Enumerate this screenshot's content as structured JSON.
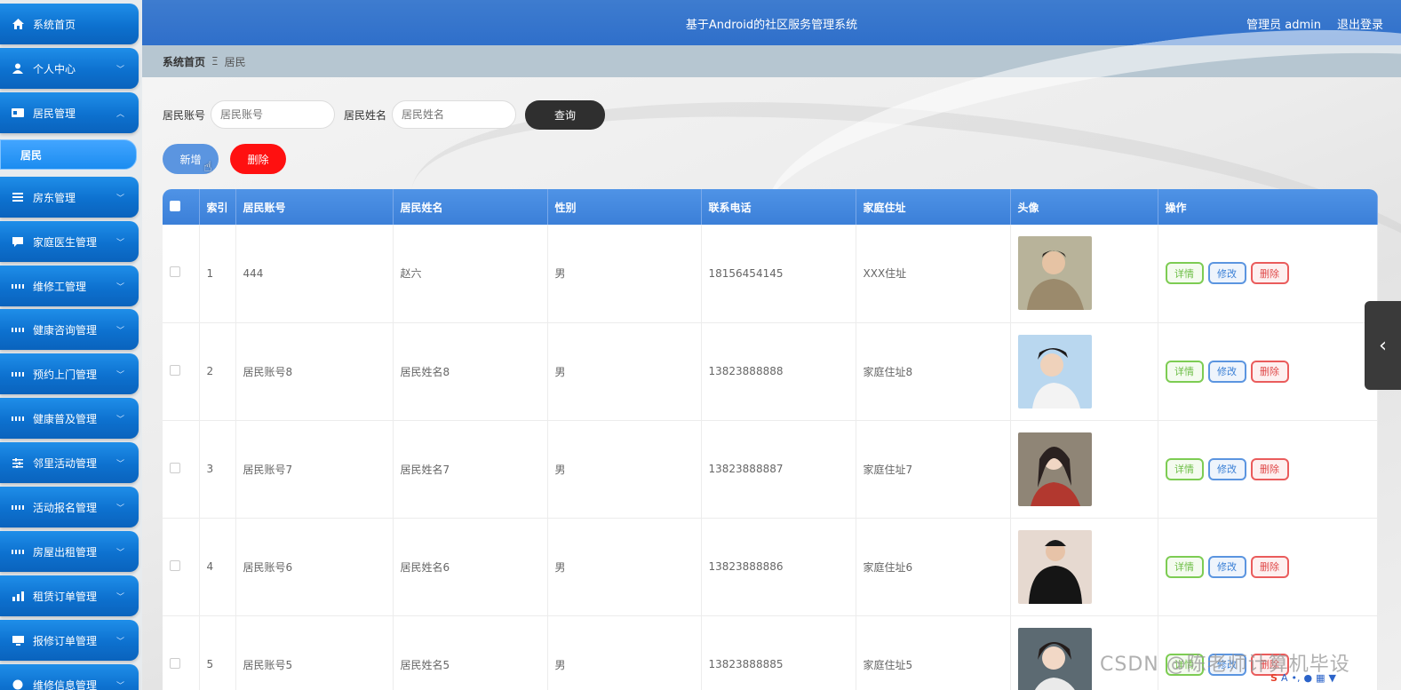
{
  "app": {
    "title": "基于Android的社区服务管理系统",
    "user": "管理员 admin",
    "logout": "退出登录"
  },
  "breadcrumb": {
    "home": "系统首页",
    "separator": "Ξ",
    "current": "居民"
  },
  "sidebar": {
    "items": [
      {
        "label": "系统首页",
        "icon": "home-icon"
      },
      {
        "label": "个人中心",
        "icon": "user-icon"
      },
      {
        "label": "居民管理",
        "icon": "card-icon",
        "expanded": true
      },
      {
        "label": "房东管理",
        "icon": "list-icon"
      },
      {
        "label": "家庭医生管理",
        "icon": "chat-icon"
      },
      {
        "label": "维修工管理",
        "icon": "grid-icon"
      },
      {
        "label": "健康咨询管理",
        "icon": "grid-icon"
      },
      {
        "label": "预约上门管理",
        "icon": "grid-icon"
      },
      {
        "label": "健康普及管理",
        "icon": "grid-icon"
      },
      {
        "label": "邻里活动管理",
        "icon": "sliders-icon"
      },
      {
        "label": "活动报名管理",
        "icon": "grid-icon"
      },
      {
        "label": "房屋出租管理",
        "icon": "grid-icon"
      },
      {
        "label": "租赁订单管理",
        "icon": "chart-icon"
      },
      {
        "label": "报修订单管理",
        "icon": "monitor-icon"
      },
      {
        "label": "维修信息管理",
        "icon": "circle-icon"
      }
    ],
    "sub_item": "居民"
  },
  "search": {
    "account_label": "居民账号",
    "account_placeholder": "居民账号",
    "name_label": "居民姓名",
    "name_placeholder": "居民姓名",
    "query_button": "查询"
  },
  "actions": {
    "add": "新增",
    "delete": "删除"
  },
  "table": {
    "columns": [
      "索引",
      "居民账号",
      "居民姓名",
      "性别",
      "联系电话",
      "家庭住址",
      "头像",
      "操作"
    ],
    "op_labels": {
      "detail": "详情",
      "edit": "修改",
      "remove": "删除"
    },
    "rows": [
      {
        "index": "1",
        "account": "444",
        "name": "赵六",
        "gender": "男",
        "phone": "18156454145",
        "address": "XXX住址"
      },
      {
        "index": "2",
        "account": "居民账号8",
        "name": "居民姓名8",
        "gender": "男",
        "phone": "13823888888",
        "address": "家庭住址8"
      },
      {
        "index": "3",
        "account": "居民账号7",
        "name": "居民姓名7",
        "gender": "男",
        "phone": "13823888887",
        "address": "家庭住址7"
      },
      {
        "index": "4",
        "account": "居民账号6",
        "name": "居民姓名6",
        "gender": "男",
        "phone": "13823888886",
        "address": "家庭住址6"
      },
      {
        "index": "5",
        "account": "居民账号5",
        "name": "居民姓名5",
        "gender": "男",
        "phone": "13823888885",
        "address": "家庭住址5"
      }
    ]
  },
  "watermark": "CSDN @陈老师计算机毕设",
  "colors": {
    "sidebar": "#0d71cf",
    "header": "#3e7ccf",
    "table_header": "#4f93e6",
    "danger": "#ff1010",
    "query": "#2f2f2f"
  }
}
